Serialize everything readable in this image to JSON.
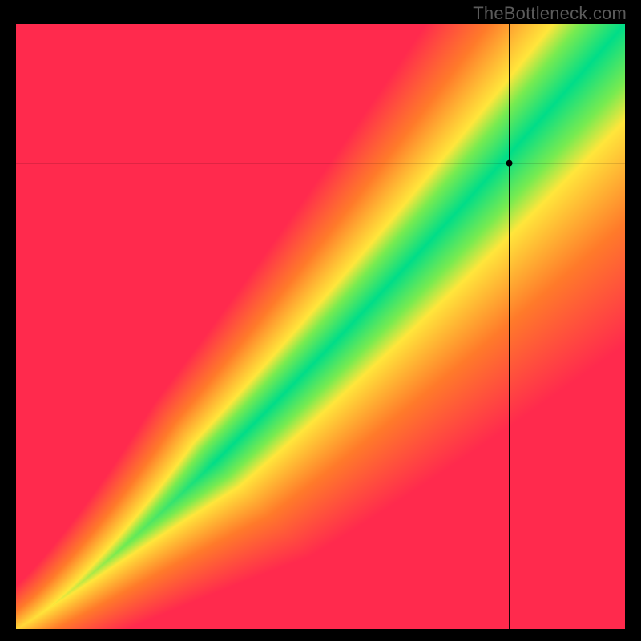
{
  "watermark": "TheBottleneck.com",
  "chart_data": {
    "type": "heatmap",
    "title": "",
    "xlabel": "",
    "ylabel": "",
    "xlim": [
      0,
      100
    ],
    "ylim": [
      0,
      100
    ],
    "colormap": {
      "description": "red→yellow→green by distance from optimal diagonal band",
      "red": "#ff2a4d",
      "orange": "#ff7a2a",
      "yellow": "#ffe63b",
      "green": "#00dd88"
    },
    "band": {
      "description": "green optimal band approximated as power curve y ≈ 100*(x/100)^1.15 with widening half-width",
      "exponent": 1.15,
      "base_halfwidth_pct": 2.0,
      "halfwidth_growth": 0.075
    },
    "crosshair": {
      "x": 81,
      "y": 77,
      "point_radius_px": 4
    },
    "grid": false,
    "legend": null
  }
}
